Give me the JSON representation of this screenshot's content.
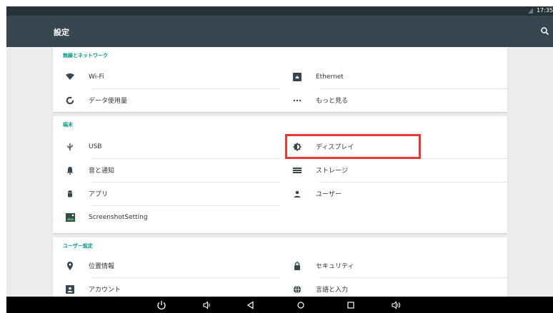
{
  "status_bar": {
    "time": "17:35",
    "icons": [
      "sim-icon"
    ]
  },
  "action_bar": {
    "title": "設定",
    "search_icon": "search-icon"
  },
  "sections": [
    {
      "header": "無線とネットワーク",
      "items": [
        {
          "label": "Wi-Fi",
          "icon": "wifi-icon"
        },
        {
          "label": "Ethernet",
          "icon": "ethernet-icon"
        },
        {
          "label": "データ使用量",
          "icon": "data-usage-icon"
        },
        {
          "label": "もっと見る",
          "icon": "more-icon"
        }
      ]
    },
    {
      "header": "端末",
      "items": [
        {
          "label": "USB",
          "icon": "usb-icon"
        },
        {
          "label": "ディスプレイ",
          "icon": "brightness-icon"
        },
        {
          "label": "音と通知",
          "icon": "bell-icon"
        },
        {
          "label": "ストレージ",
          "icon": "storage-icon"
        },
        {
          "label": "アプリ",
          "icon": "android-icon"
        },
        {
          "label": "ユーザー",
          "icon": "user-icon"
        },
        {
          "label": "ScreenshotSetting",
          "icon": "image-icon"
        }
      ]
    },
    {
      "header": "ユーザー設定",
      "items": [
        {
          "label": "位置情報",
          "icon": "location-icon"
        },
        {
          "label": "セキュリティ",
          "icon": "lock-icon"
        },
        {
          "label": "アカウント",
          "icon": "account-icon"
        },
        {
          "label": "言語と入力",
          "icon": "globe-icon"
        }
      ]
    }
  ],
  "highlighted_item": "ディスプレイ",
  "highlight_color": "#e53935",
  "accent_color": "#009688",
  "nav_bar": {
    "buttons": [
      "power-icon",
      "volume-down-icon",
      "back-icon",
      "home-icon",
      "recents-icon",
      "volume-up-icon"
    ]
  }
}
